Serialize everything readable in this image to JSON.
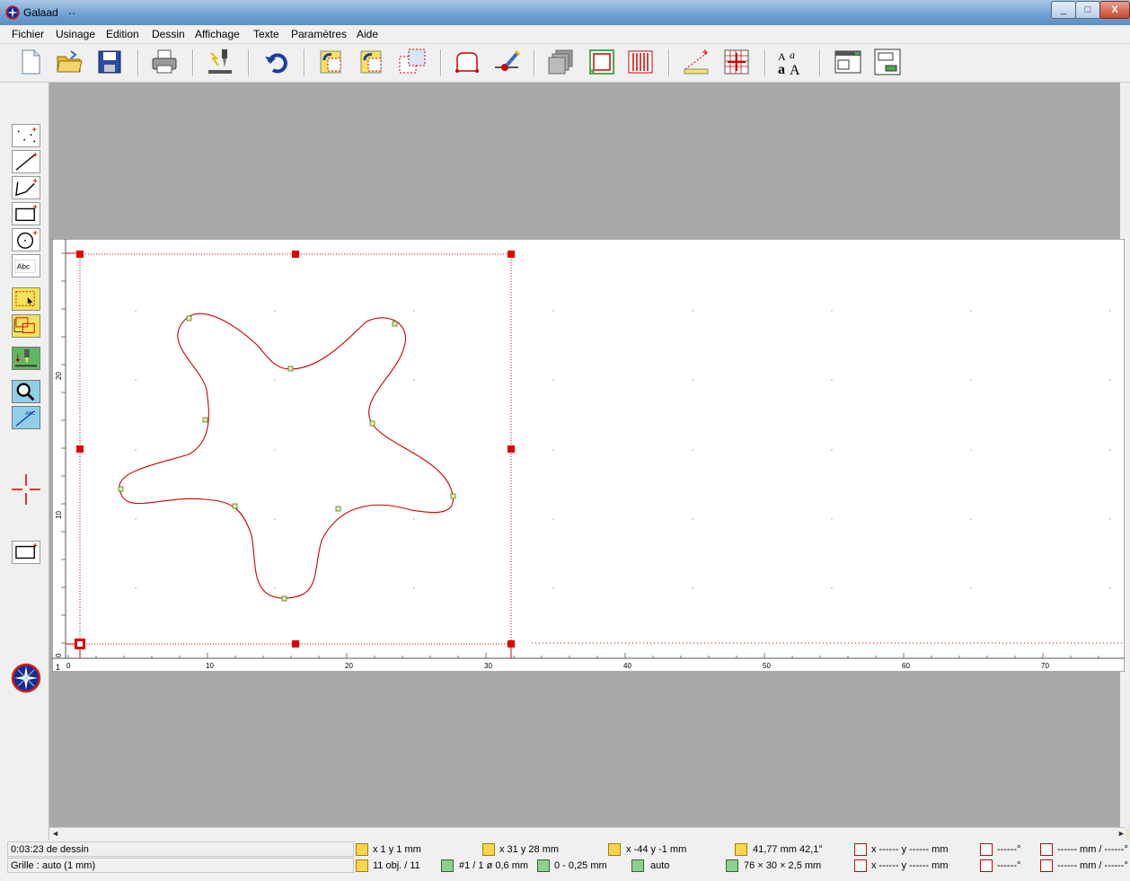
{
  "window": {
    "title": "Galaad",
    "title_suffix": "··",
    "min": "_",
    "max": "□",
    "close": "X"
  },
  "menu": [
    "Fichier",
    "Usinage",
    "Edition",
    "Dessin",
    "Affichage",
    "Texte",
    "Paramètres",
    "Aide"
  ],
  "toolbar": [
    "new-file",
    "open-folder",
    "save-disk",
    "print",
    "machine-tool",
    "undo",
    "rotate-clockwise",
    "rotate-counterclockwise",
    "array-copy",
    "trace-shape",
    "laser-tool",
    "layers",
    "select-frame",
    "stripes",
    "measure-line",
    "grid",
    "text-font",
    "window-layout",
    "window-sub-layout"
  ],
  "palette": [
    "point-tool",
    "line-tool",
    "polyline-tool",
    "rectangle-tool",
    "circle-tool",
    "text-tool",
    "select-tool",
    "move-tool",
    "machine-tool",
    "zoom-tool",
    "dimension-tool"
  ],
  "canvas": {
    "x_ticks": [
      "0",
      "10",
      "20",
      "30",
      "40",
      "50",
      "60",
      "70"
    ],
    "y_ticks": [
      "20",
      "10",
      "0"
    ],
    "corner": "1",
    "curve_color": "#cc0000",
    "selection_color": "#e00000"
  },
  "status": {
    "time": "0:03:23 de dessin",
    "grid": "Grille : auto  (1 mm)",
    "pos1": "x 1    y 1  mm",
    "pos2": "x 31    y 28  mm",
    "pos3": "x -44    y -1  mm",
    "dist": "41,77 mm   42,1°",
    "coord_a": "x ------      y ------    mm",
    "angle_a": "------°",
    "len_a": "------ mm / ------°",
    "objects": "11 obj. / 11",
    "tool": "#1 / 1    ø 0,6 mm",
    "depth": "0 - 0,25 mm",
    "mode": "auto",
    "size": "76 × 30 × 2,5 mm",
    "coord_b": "x ------      y ------    mm",
    "angle_b": "------°",
    "len_b": "------ mm / ------°"
  }
}
